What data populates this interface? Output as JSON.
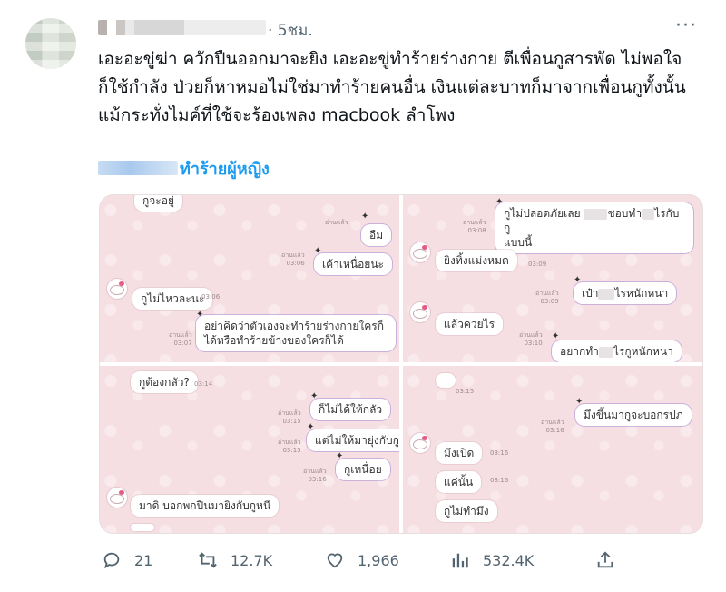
{
  "tweet": {
    "time": "· 5ชม.",
    "more": "···",
    "text": "เอะอะขู่ฆ่า ควักปืนออกมาจะยิง เอะอะขู่ทำร้ายร่างกาย ตีเพื่อนกูสารพัด ไม่พอใจก็ใช้กำลัง ป่วยก็หาหมอไม่ใช่มาทำร้ายคนอื่น เงินแต่ละบาทก็มาจากเพื่อนกูทั้งนั้นแม้กระทั่งไมค์ที่ใช้จะร้องเพลง macbook ลำโพง",
    "hashtag": "ทำร้ายผู้หญิง"
  },
  "chat": {
    "p1": {
      "top_msg": "กูจะอยู่",
      "m1": "อืม",
      "m2": "เค้าเหนื่อยนะ",
      "m3": "กูไม่ไหวละนะ",
      "m4a": "อย่าคิดว่าตัวเองจะทำร้ายร่างกายใครก็",
      "m4b": "ได้หรือทำร้ายข้างของใครก็ได้",
      "read": "อ่านแล้ว",
      "t1": "03:06",
      "t2": "03:06",
      "t3": "03:07",
      "t4": "03:07"
    },
    "p2": {
      "m1a": "กูไม่ปลอดภัยเลย",
      "m1b": "ชอบทำ",
      "m1c": "ไรกับกู",
      "m1d": "แบบนี้",
      "m2": "ยิงทิ้งแม่งหมด",
      "m3a": "เป๋า",
      "m3b": "ไรหนักหนา",
      "m4": "แล้วควยไร",
      "m5a": "อยากทำ",
      "m5b": "ไรกูหนักหนา",
      "read": "อ่านแล้ว",
      "t1": "03:08",
      "t2": "03:09",
      "t3": "03:09",
      "t4": "03:10"
    },
    "p3": {
      "m1": "กูต้องกลัว?",
      "m2": "ก็ไม่ได้ให้กลัว",
      "m3": "แต่ไม่ให้มายุ่งกับกู",
      "m4": "กูเหนื่อย",
      "m5": "มาดิ บอกพกปืนมายิงกับกูหนี",
      "read": "อ่านแล้ว",
      "t1": "03:14",
      "t2": "03:15",
      "t3": "03:15",
      "t4": "03:16"
    },
    "p4": {
      "m1": "มึงขึ้นมากูจะบอกรปภ",
      "m2": "มึงเปิด",
      "m3": "แค่นั้น",
      "m4": "กูไม่ทำมึง",
      "read": "อ่านแล้ว",
      "t1": "03:15",
      "t2": "03:16",
      "t3": "03:16",
      "t4": "03:16"
    }
  },
  "actions": {
    "reply_count": "21",
    "retweet_count": "12.7K",
    "like_count": "1,966",
    "views_count": "532.4K"
  },
  "icons": {
    "reply": "reply-icon",
    "retweet": "retweet-icon",
    "like": "heart-icon",
    "views": "views-icon",
    "share": "share-icon"
  },
  "colors": {
    "accent": "#1d9bf0",
    "muted": "#536471",
    "chat_bg": "#f6dfe3"
  }
}
